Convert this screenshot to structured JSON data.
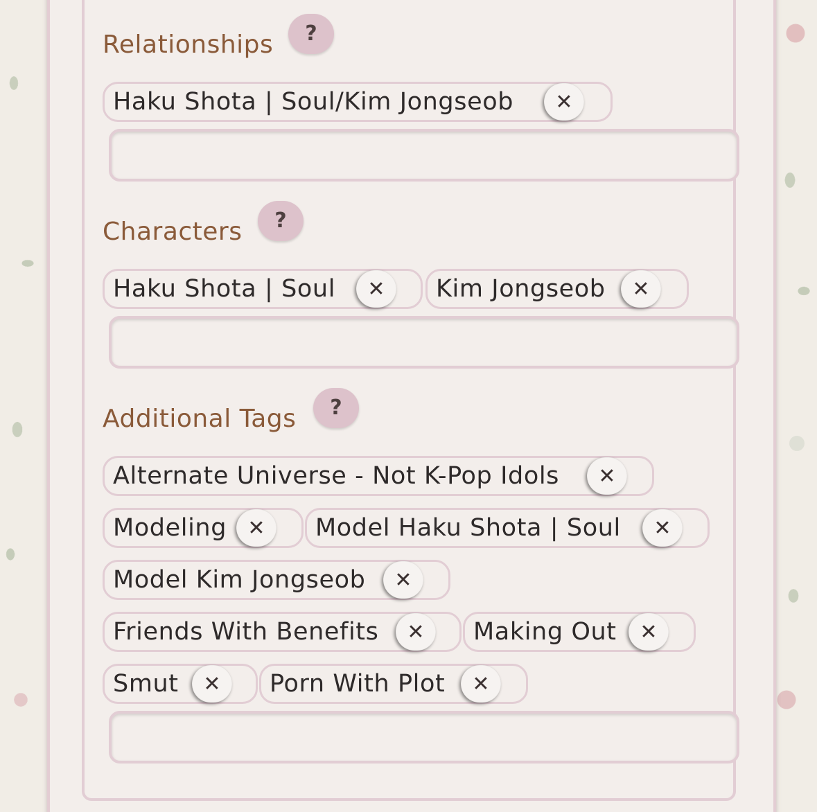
{
  "sections": {
    "relationships": {
      "label": "Relationships",
      "help": "?",
      "tags": [
        {
          "text": "Haku Shota | Soul/Kim Jongseob",
          "remove": "✕"
        }
      ]
    },
    "characters": {
      "label": "Characters",
      "help": "?",
      "tags": [
        {
          "text": "Haku Shota | Soul",
          "remove": "✕"
        },
        {
          "text": "Kim Jongseob",
          "remove": "✕"
        }
      ]
    },
    "additional": {
      "label": "Additional Tags",
      "help": "?",
      "tags": [
        {
          "text": "Alternate Universe - Not K-Pop Idols",
          "remove": "✕"
        },
        {
          "text": "Modeling",
          "remove": "✕"
        },
        {
          "text": "Model Haku Shota | Soul",
          "remove": "✕"
        },
        {
          "text": "Model Kim Jongseob",
          "remove": "✕"
        },
        {
          "text": "Friends With Benefits",
          "remove": "✕"
        },
        {
          "text": "Making Out",
          "remove": "✕"
        },
        {
          "text": "Smut",
          "remove": "✕"
        },
        {
          "text": "Porn With Plot",
          "remove": "✕"
        }
      ]
    }
  },
  "icons": {
    "help": "question-mark-icon",
    "remove": "close-icon"
  },
  "colors": {
    "label": "#8a5a39",
    "border": "#e2cdd4",
    "help_bg": "#ddc2cb",
    "panel_bg": "#f3eeeb"
  }
}
